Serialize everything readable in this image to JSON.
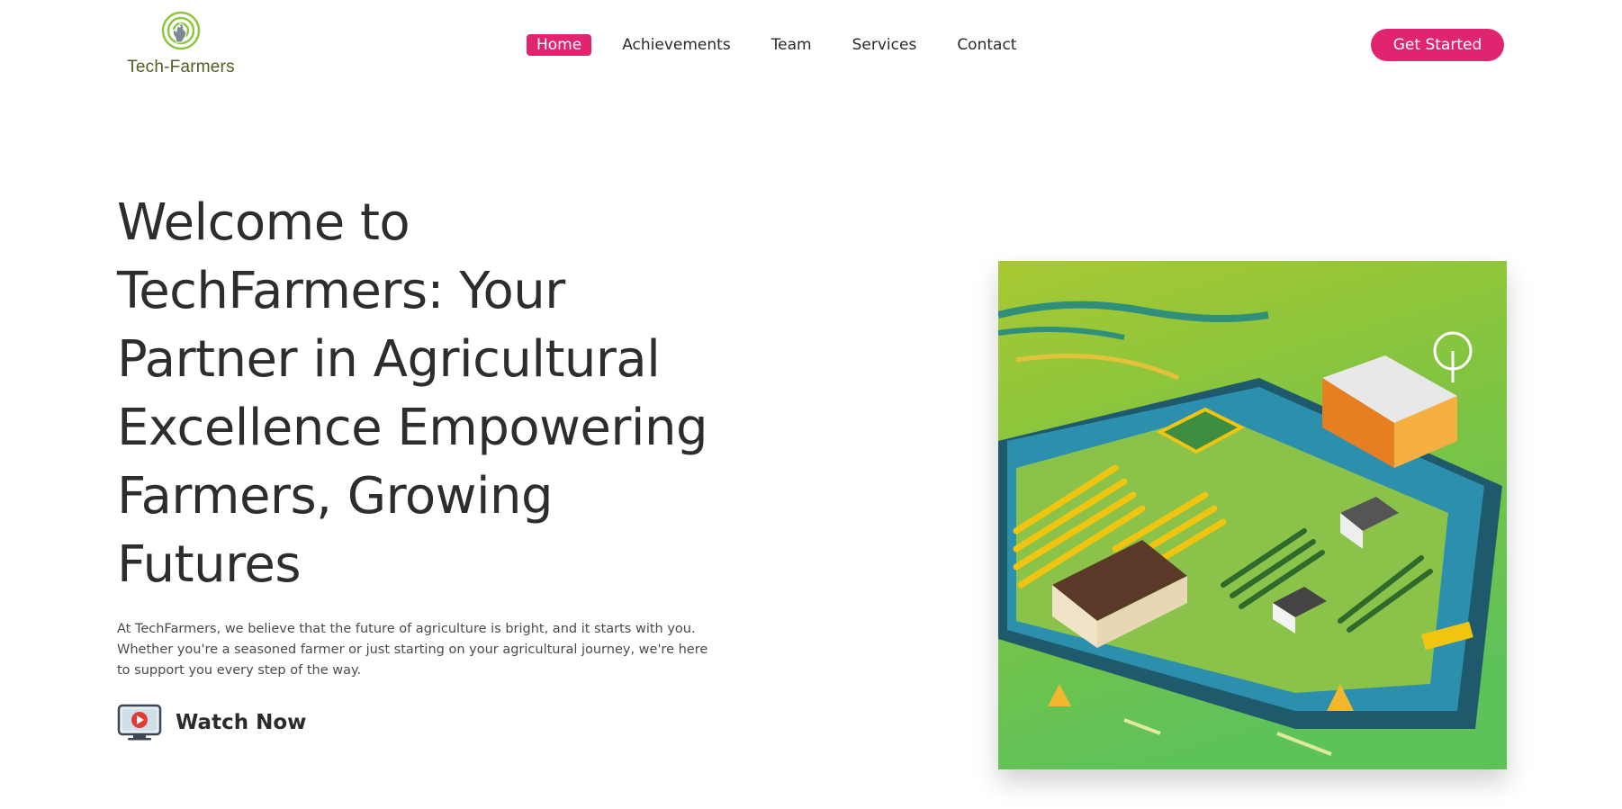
{
  "brand": {
    "name": "Tech-Farmers",
    "accent": "#e0246f",
    "logo_color": "#8cc63f"
  },
  "nav": {
    "items": [
      {
        "label": "Home",
        "active": true
      },
      {
        "label": "Achievements",
        "active": false
      },
      {
        "label": "Team",
        "active": false
      },
      {
        "label": "Services",
        "active": false
      },
      {
        "label": "Contact",
        "active": false
      }
    ],
    "cta_label": "Get Started"
  },
  "hero": {
    "title": "Welcome to TechFarmers: Your Partner in Agricultural Excellence Empowering Farmers, Growing Futures",
    "description": "At TechFarmers, we believe that the future of agriculture is bright, and it starts with you. Whether you're a seasoned farmer or just starting on your agricultural journey, we're here to support you every step of the way.",
    "watch_label": "Watch Now",
    "watch_icon": "video-play-icon",
    "image_icon": "farm-illustration"
  }
}
